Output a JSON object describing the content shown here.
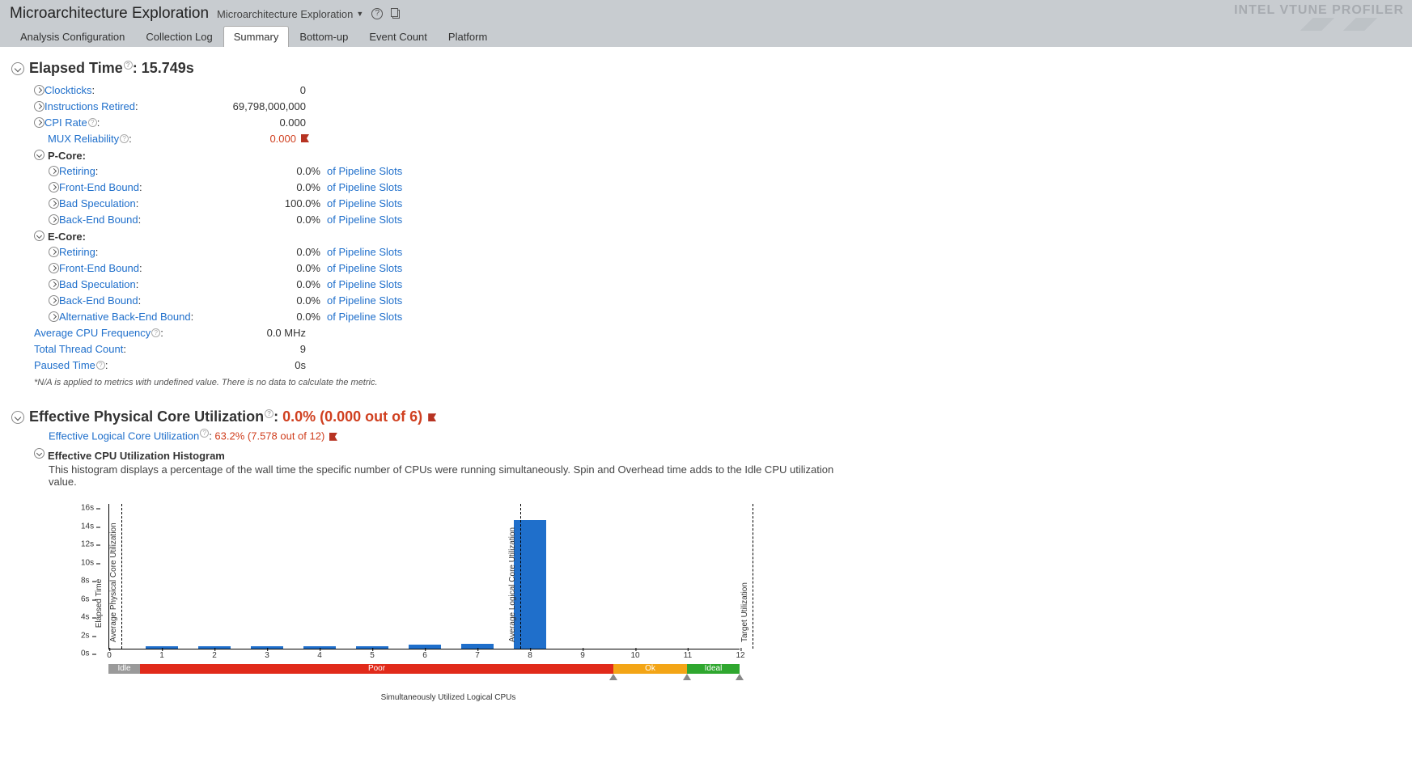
{
  "header": {
    "title": "Microarchitecture Exploration",
    "breadcrumb": "Microarchitecture Exploration",
    "brand": "INTEL VTUNE PROFILER"
  },
  "tabs": [
    {
      "label": "Analysis Configuration",
      "active": false
    },
    {
      "label": "Collection Log",
      "active": false
    },
    {
      "label": "Summary",
      "active": true
    },
    {
      "label": "Bottom-up",
      "active": false
    },
    {
      "label": "Event Count",
      "active": false
    },
    {
      "label": "Platform",
      "active": false
    }
  ],
  "elapsed": {
    "title_label": "Elapsed Time",
    "title_value": ": 15.749s",
    "rows": [
      {
        "label": "Clockticks",
        "value": "0"
      },
      {
        "label": "Instructions Retired",
        "value": "69,798,000,000"
      },
      {
        "label": "CPI Rate",
        "value": "0.000",
        "help": true
      },
      {
        "label": "MUX Reliability",
        "value": "0.000",
        "help": true,
        "red": true,
        "flag": true,
        "no_chevron": true
      }
    ],
    "pcore_label": "P-Core:",
    "pcore": [
      {
        "label": "Retiring",
        "value": "0.0%",
        "unit": "of Pipeline Slots"
      },
      {
        "label": "Front-End Bound",
        "value": "0.0%",
        "unit": "of Pipeline Slots"
      },
      {
        "label": "Bad Speculation",
        "value": "100.0%",
        "unit": "of Pipeline Slots"
      },
      {
        "label": "Back-End Bound",
        "value": "0.0%",
        "unit": "of Pipeline Slots"
      }
    ],
    "ecore_label": "E-Core:",
    "ecore": [
      {
        "label": "Retiring",
        "value": "0.0%",
        "unit": "of Pipeline Slots"
      },
      {
        "label": "Front-End Bound",
        "value": "0.0%",
        "unit": "of Pipeline Slots"
      },
      {
        "label": "Bad Speculation",
        "value": "0.0%",
        "unit": "of Pipeline Slots"
      },
      {
        "label": "Back-End Bound",
        "value": "0.0%",
        "unit": "of Pipeline Slots"
      },
      {
        "label": "Alternative Back-End Bound",
        "value": "0.0%",
        "unit": "of Pipeline Slots"
      }
    ],
    "tail": [
      {
        "label": "Average CPU Frequency",
        "value": "0.0 MHz",
        "help": true
      },
      {
        "label": "Total Thread Count",
        "value": "9"
      },
      {
        "label": "Paused Time",
        "value": "0s",
        "help": true
      }
    ],
    "footnote": "*N/A is applied to metrics with undefined value. There is no data to calculate the metric."
  },
  "util": {
    "title_label": "Effective Physical Core Utilization",
    "title_value": ": ",
    "title_red": "0.0% (0.000 out of 6)",
    "sub_label": "Effective Logical Core Utilization",
    "sub_value": "63.2% (7.578 out of 12)",
    "hist_title": "Effective CPU Utilization Histogram",
    "hist_desc": "This histogram displays a percentage of the wall time the specific number of CPUs were running simultaneously. Spin and Overhead time adds to the Idle CPU utilization value."
  },
  "chart_data": {
    "type": "bar",
    "categories": [
      "0",
      "1",
      "2",
      "3",
      "4",
      "5",
      "6",
      "7",
      "8",
      "9",
      "10",
      "11",
      "12"
    ],
    "values": [
      0,
      0.3,
      0.3,
      0.3,
      0.3,
      0.3,
      0.5,
      0.6,
      14.2,
      0,
      0,
      0,
      0
    ],
    "ylabel": "Elapsed Time",
    "xlabel": "Simultaneously Utilized Logical CPUs",
    "ylim": [
      0,
      16
    ],
    "yticks": [
      "0s",
      "2s",
      "4s",
      "6s",
      "8s",
      "10s",
      "12s",
      "14s",
      "16s"
    ],
    "vlines": [
      {
        "x": 0,
        "label": "Average Physical Core Utilization"
      },
      {
        "x": 7.578,
        "label": "Average Logical Core Utilization"
      },
      {
        "x": 12,
        "label": "Target Utilization"
      }
    ],
    "zones": [
      {
        "label": "Idle",
        "from": 0,
        "to": 0.6,
        "color": "#9a9a9a"
      },
      {
        "label": "Poor",
        "from": 0.6,
        "to": 9.6,
        "color": "#e12a1a"
      },
      {
        "label": "Ok",
        "from": 9.6,
        "to": 11.0,
        "color": "#f3a516"
      },
      {
        "label": "Ideal",
        "from": 11.0,
        "to": 12,
        "color": "#2fa72f"
      }
    ],
    "handles": [
      9.6,
      11.0,
      12.0
    ]
  }
}
